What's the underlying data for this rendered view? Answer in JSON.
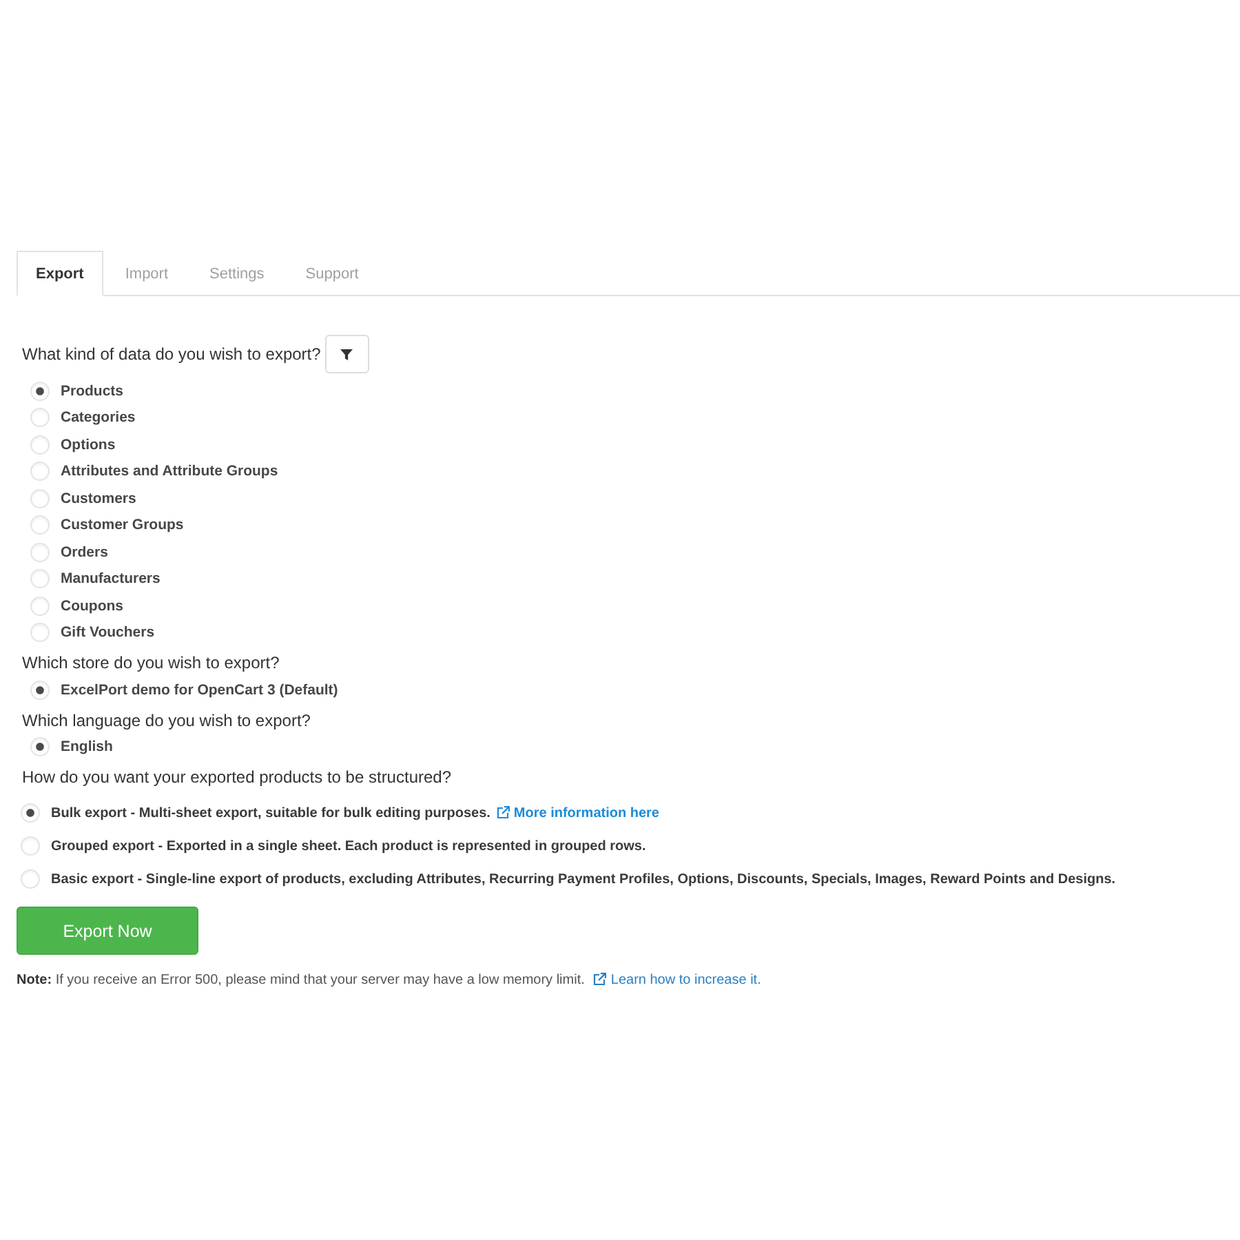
{
  "tabs": [
    {
      "label": "Export",
      "selected": true
    },
    {
      "label": "Import",
      "selected": false
    },
    {
      "label": "Settings",
      "selected": false
    },
    {
      "label": "Support",
      "selected": false
    }
  ],
  "data_type": {
    "question": "What kind of data do you wish to export?",
    "options": [
      {
        "label": "Products",
        "selected": true
      },
      {
        "label": "Categories",
        "selected": false
      },
      {
        "label": "Options",
        "selected": false
      },
      {
        "label": "Attributes and Attribute Groups",
        "selected": false
      },
      {
        "label": "Customers",
        "selected": false
      },
      {
        "label": "Customer Groups",
        "selected": false
      },
      {
        "label": "Orders",
        "selected": false
      },
      {
        "label": "Manufacturers",
        "selected": false
      },
      {
        "label": "Coupons",
        "selected": false
      },
      {
        "label": "Gift Vouchers",
        "selected": false
      }
    ]
  },
  "store": {
    "question": "Which store do you wish to export?",
    "options": [
      {
        "label": "ExcelPort demo for OpenCart 3 (Default)",
        "selected": true
      }
    ]
  },
  "language": {
    "question": "Which language do you wish to export?",
    "options": [
      {
        "label": "English",
        "selected": true
      }
    ]
  },
  "structure": {
    "question": "How do you want your exported products to be structured?",
    "options": [
      {
        "label": "Bulk export - Multi-sheet export, suitable for bulk editing purposes.",
        "selected": true,
        "link": "More information here"
      },
      {
        "label": "Grouped export - Exported in a single sheet. Each product is represented in grouped rows.",
        "selected": false
      },
      {
        "label": "Basic export - Single-line export of products, excluding Attributes, Recurring Payment Profiles, Options, Discounts, Specials, Images, Reward Points and Designs.",
        "selected": false
      }
    ]
  },
  "export_button": "Export Now",
  "note": {
    "text": "**Note:** If you receive an Error 500, please mind that your server may have a low memory limit.",
    "link": "Learn how to increase it."
  }
}
